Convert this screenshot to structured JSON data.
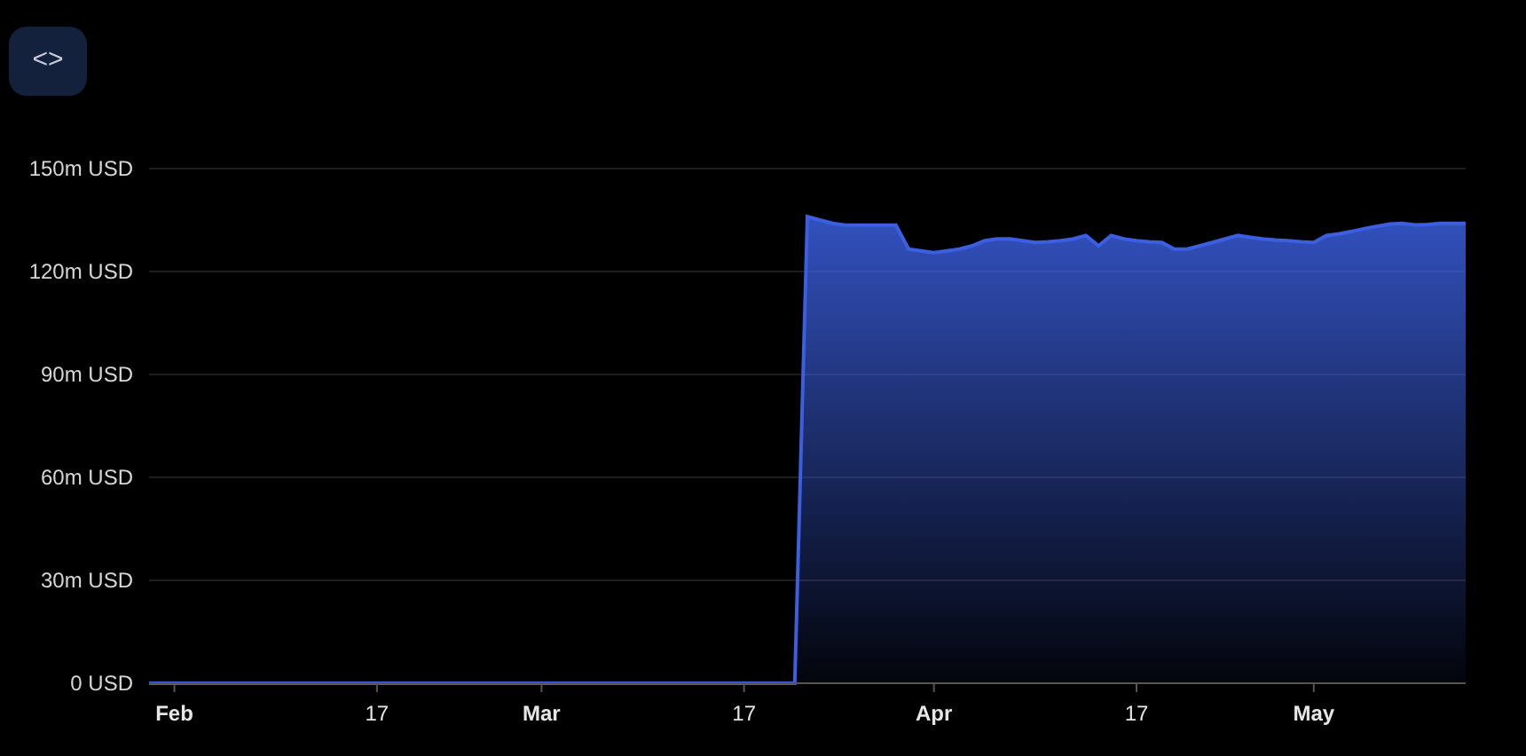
{
  "embed_button": {
    "label": "<>"
  },
  "chart": {
    "chart_data": {
      "type": "area",
      "categories": [
        null,
        null,
        "Feb",
        null,
        null,
        null,
        null,
        null,
        null,
        null,
        null,
        null,
        null,
        null,
        null,
        null,
        null,
        null,
        "17",
        null,
        null,
        null,
        null,
        null,
        null,
        null,
        null,
        null,
        null,
        null,
        null,
        "Mar",
        null,
        null,
        null,
        null,
        null,
        null,
        null,
        null,
        null,
        null,
        null,
        null,
        null,
        null,
        null,
        "17",
        null,
        null,
        null,
        null,
        null,
        null,
        null,
        null,
        null,
        null,
        null,
        null,
        null,
        null,
        "Apr",
        null,
        null,
        null,
        null,
        null,
        null,
        null,
        null,
        null,
        null,
        null,
        null,
        null,
        null,
        null,
        "17",
        null,
        null,
        null,
        null,
        null,
        null,
        null,
        null,
        null,
        null,
        null,
        null,
        null,
        "May",
        null,
        null,
        null,
        null,
        null,
        null,
        null,
        null,
        null,
        null,
        null,
        null
      ],
      "series": [
        {
          "color": "#3b5fe0",
          "values": [
            0,
            0,
            0,
            0,
            0,
            0,
            0,
            0,
            0,
            0,
            0,
            0,
            0,
            0,
            0,
            0,
            0,
            0,
            0,
            0,
            0,
            0,
            0,
            0,
            0,
            0,
            0,
            0,
            0,
            0,
            0,
            0,
            0,
            0,
            0,
            0,
            0,
            0,
            0,
            0,
            0,
            0,
            0,
            0,
            0,
            0,
            0,
            0,
            0,
            0,
            0,
            0,
            136,
            135,
            134,
            133.5,
            133.5,
            133.5,
            133.5,
            133.5,
            126.5,
            126,
            125.5,
            126,
            126.5,
            127.5,
            129,
            129.5,
            129.5,
            129,
            128.5,
            128.7,
            129,
            129.5,
            130.5,
            127.5,
            130.5,
            129.5,
            129,
            128.7,
            128.5,
            126.5,
            126.5,
            127.5,
            128.5,
            129.5,
            130.5,
            130,
            129.5,
            129.2,
            129,
            128.7,
            128.5,
            130.5,
            131,
            131.7,
            132.5,
            133.2,
            133.8,
            134,
            133.6,
            133.7,
            134,
            134,
            134
          ]
        }
      ],
      "ylim": [
        0,
        150
      ],
      "grid": true,
      "yticks": [
        {
          "value": 0,
          "label": "0 USD"
        },
        {
          "value": 30,
          "label": "30m USD"
        },
        {
          "value": 60,
          "label": "60m USD"
        },
        {
          "value": 90,
          "label": "90m USD"
        },
        {
          "value": 120,
          "label": "120m USD"
        },
        {
          "value": 150,
          "label": "150m USD"
        }
      ]
    }
  }
}
